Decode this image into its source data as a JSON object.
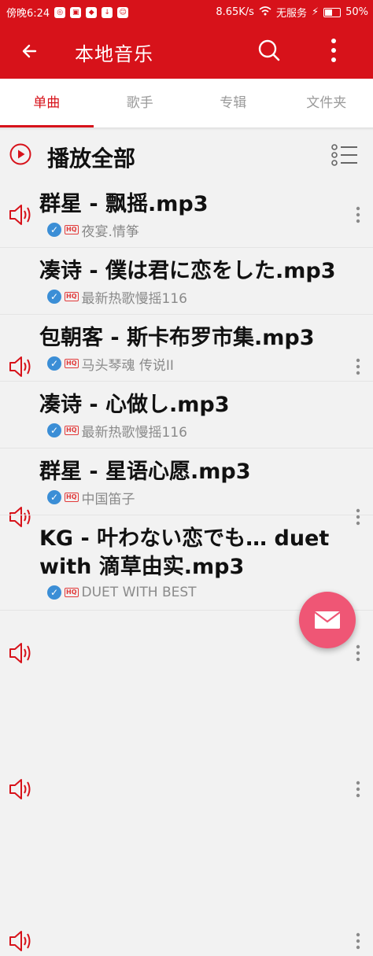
{
  "status_bar": {
    "time": "傍晚6:24",
    "speed": "8.65K/s",
    "carrier": "无服务",
    "battery": "50%"
  },
  "app_bar": {
    "title": "本地音乐"
  },
  "tabs": [
    {
      "label": "单曲",
      "active": true
    },
    {
      "label": "歌手",
      "active": false
    },
    {
      "label": "专辑",
      "active": false
    },
    {
      "label": "文件夹",
      "active": false
    }
  ],
  "play_all": {
    "label": "播放全部"
  },
  "songs": [
    {
      "title": "群星 - 飘摇.mp3",
      "album": "夜宴.情筝"
    },
    {
      "title": "凑诗 - 僕は君に恋をした.mp3",
      "album": "最新热歌慢摇116"
    },
    {
      "title": "包朝客 - 斯卡布罗市集.mp3",
      "album": "马头琴魂 传说II"
    },
    {
      "title": "凑诗 - 心做し.mp3",
      "album": "最新热歌慢摇116"
    },
    {
      "title": "群星 - 星语心愿.mp3",
      "album": "中国笛子"
    },
    {
      "title": "KG - 叶わない恋でも… duet with 滴草由实.mp3",
      "album": "DUET WITH BEST"
    }
  ],
  "colors": {
    "primary": "#d7121a",
    "fab": "#ef5675",
    "check": "#3b8ed6"
  }
}
